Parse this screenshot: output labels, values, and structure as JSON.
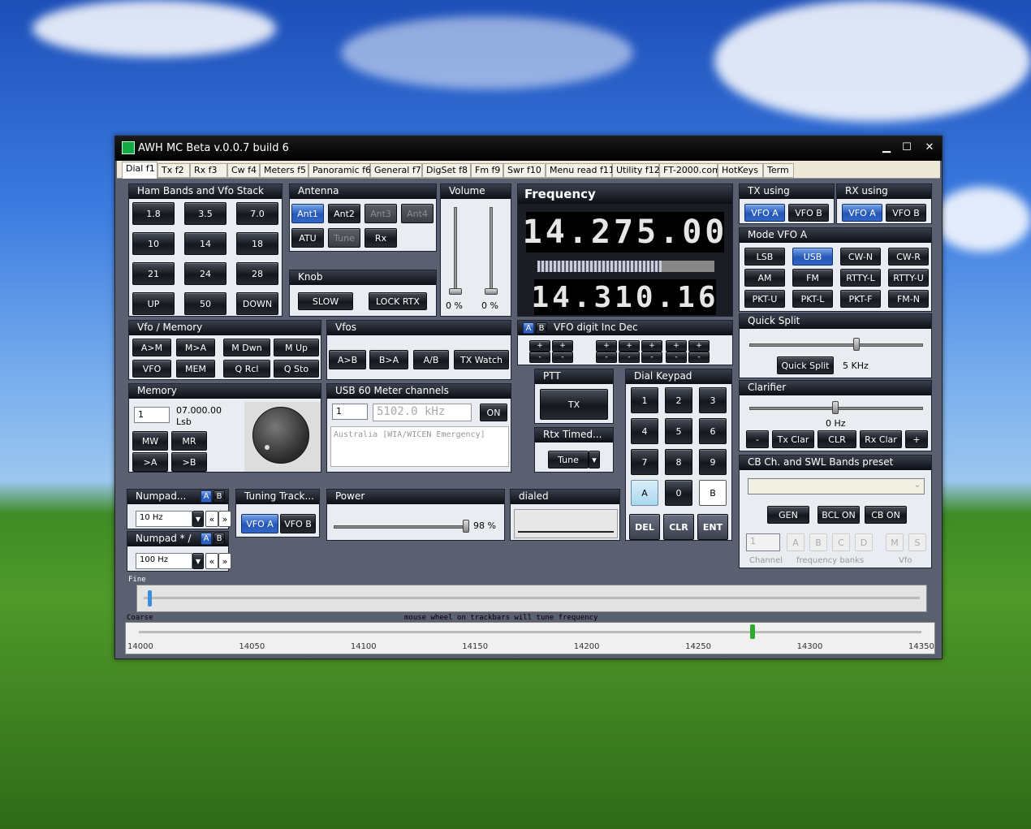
{
  "window": {
    "title": "AWH MC Beta v.0.0.7 build 6",
    "minimize": "▁",
    "maximize": "☐",
    "close": "✕"
  },
  "tabs": [
    "Dial  f1",
    "Tx  f2",
    "Rx  f3",
    "Cw  f4",
    "Meters  f5",
    "Panoramic  f6",
    "General  f7",
    "DigSet  f8",
    "Fm  f9",
    "Swr  f10",
    "Menu read  f11",
    "Utility  f12",
    "FT-2000.com",
    "HotKeys",
    "Term"
  ],
  "ham_bands": {
    "title": "Ham Bands and Vfo Stack",
    "buttons": [
      "1.8",
      "3.5",
      "7.0",
      "10",
      "14",
      "18",
      "21",
      "24",
      "28",
      "UP",
      "50",
      "DOWN"
    ]
  },
  "antenna": {
    "title": "Antenna",
    "buttons": [
      "Ant1",
      "Ant2",
      "Ant3",
      "Ant4",
      "ATU",
      "Tune",
      "Rx"
    ]
  },
  "knob": {
    "title": "Knob",
    "slow": "SLOW",
    "lock": "LOCK RTX"
  },
  "volume": {
    "title": "Volume",
    "left_value": "0 %",
    "right_value": "0 %",
    "left_level": 0,
    "right_level": 0
  },
  "frequency": {
    "title": "Frequency",
    "main": "14.275.00",
    "sub": "14.310.16",
    "bar_level": 0.7
  },
  "tx_using": {
    "title": "TX using",
    "a": "VFO A",
    "b": "VFO B"
  },
  "rx_using": {
    "title": "RX using",
    "a": "VFO A",
    "b": "VFO B"
  },
  "mode": {
    "title": "Mode VFO A",
    "buttons": [
      "LSB",
      "USB",
      "CW-N",
      "CW-R",
      "AM",
      "FM",
      "RTTY-L",
      "RTTY-U",
      "PKT-U",
      "PKT-L",
      "PKT-F",
      "FM-N"
    ],
    "selected": "USB"
  },
  "quick_split": {
    "title": "Quick Split",
    "button": "Quick Split",
    "value": "5 KHz"
  },
  "clarifier": {
    "title": "Clarifier",
    "value": "0 Hz",
    "minus": "-",
    "tx_clar": "Tx Clar",
    "clr": "CLR",
    "rx_clar": "Rx Clar",
    "plus": "+"
  },
  "vfo_memory": {
    "title": "Vfo / Memory",
    "buttons": [
      "A>M",
      "M>A",
      "M Dwn",
      "M Up",
      "VFO",
      "MEM",
      "Q Rcl",
      "Q Sto"
    ]
  },
  "vfos": {
    "title": "Vfos",
    "buttons": [
      "A>B",
      "B>A",
      "A/B",
      "TX Watch"
    ]
  },
  "vfo_digit": {
    "a": "A",
    "b": "B",
    "title": "VFO digit Inc Dec",
    "plus": "+",
    "minus": "-"
  },
  "memory": {
    "title": "Memory",
    "channel": "1",
    "freq": "07.000.00",
    "mode": "Lsb",
    "mw": "MW",
    "mr": "MR",
    "toa": ">A",
    "tob": ">B"
  },
  "usb60": {
    "title": "USB 60 Meter channels",
    "channel": "1",
    "freq": "5102.0 kHz",
    "on": "ON",
    "note": "Australia [WIA/WICEN Emergency]"
  },
  "ptt": {
    "title": "PTT",
    "tx": "TX"
  },
  "rtx_timed": {
    "title": "Rtx Timed...",
    "tune": "Tune",
    "arrow": "▾"
  },
  "dial_keypad": {
    "title": "Dial Keypad",
    "keys": [
      "1",
      "2",
      "3",
      "4",
      "5",
      "6",
      "7",
      "8",
      "9",
      "A",
      "0",
      "B"
    ],
    "del": "DEL",
    "clr": "CLR",
    "ent": "ENT"
  },
  "cb": {
    "title": "CB Ch. and SWL Bands preset",
    "gen": "GEN",
    "bcl": "BCL ON",
    "cbon": "CB ON",
    "channel_val": "1",
    "banks": [
      "A",
      "B",
      "C",
      "D"
    ],
    "vfo_btns": [
      "M",
      "S"
    ],
    "channel_lbl": "Channel",
    "banks_lbl": "frequency banks",
    "vfo_lbl": "Vfo"
  },
  "numpad1": {
    "title": "Numpad...",
    "a": "A",
    "b": "B",
    "value": "10 Hz"
  },
  "numpad2": {
    "title": "Numpad * /",
    "a": "A",
    "b": "B",
    "value": "100 Hz"
  },
  "tuning_track": {
    "title": "Tuning Track...",
    "a": "VFO A",
    "b": "VFO B"
  },
  "power": {
    "title": "Power",
    "value": "98 %",
    "level": 0.98
  },
  "dialed": {
    "title": "dialed"
  },
  "trackbars": {
    "fine": "Fine",
    "coarse": "Coarse",
    "hint": "mouse wheel on trackbars will tune frequency",
    "ticks": [
      "14000",
      "14050",
      "14100",
      "14150",
      "14200",
      "14250",
      "14300",
      "14350"
    ],
    "coarse_value": 14275
  }
}
